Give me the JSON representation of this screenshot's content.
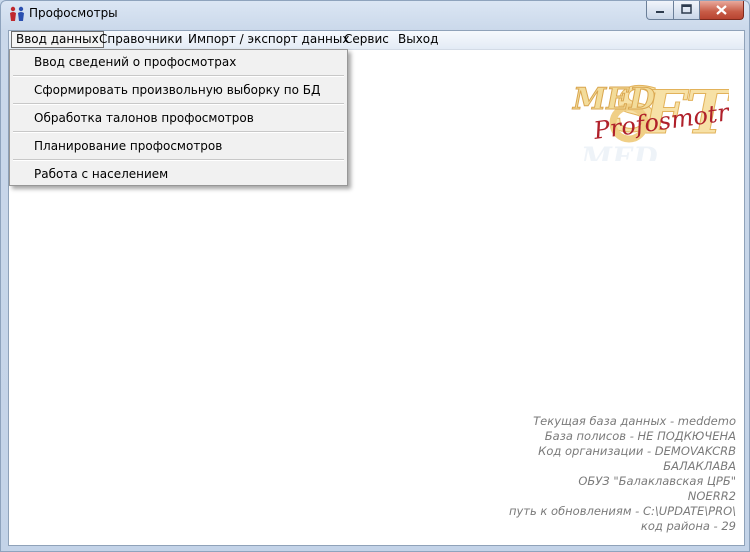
{
  "window": {
    "title": "Профосмотры"
  },
  "menubar": {
    "items": [
      "Ввод данных",
      "Справочники",
      "Импорт / экспорт данных",
      "Сервис",
      "Выход"
    ]
  },
  "dropdown": {
    "items": [
      "Ввод сведений о профосмотрах",
      "Сформировать произвольную выборку по БД",
      "Обработка талонов профосмотров",
      "Планирование профосмотров",
      "Работа с населением"
    ]
  },
  "logo": {
    "brand": "MED SOFT",
    "product": "Profosmotr"
  },
  "status": {
    "lines": [
      "Текущая база данных - meddemo",
      "База полисов - НЕ ПОДКЮЧЕНА",
      "Код организации - DEMOVAKCRB",
      "БАЛАКЛАВА",
      "ОБУЗ \"Балаклавская ЦРБ\"",
      "NOERR2",
      "путь к обновлениям - C:\\UPDATE\\PRO\\",
      "код района - 29"
    ]
  },
  "colors": {
    "close_button": "#c75b46",
    "logo_yellow": "#f5d27a",
    "logo_red": "#b0202a",
    "status_text": "#7a7a7a"
  }
}
